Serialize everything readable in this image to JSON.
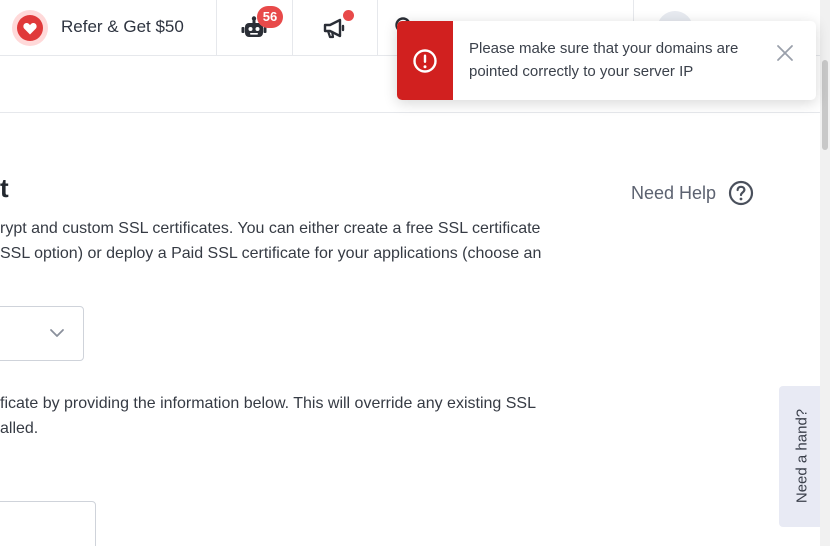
{
  "topbar": {
    "refer_label": "Refer & Get $50",
    "bot_badge": "56",
    "icons": [
      "heart-icon",
      "robot-icon",
      "megaphone-icon",
      "search-icon"
    ]
  },
  "main": {
    "title_fragment": "t",
    "para1_line1": "rypt and custom SSL certificates. You can either create a free SSL certificate",
    "para1_line2": "SSL option) or deploy a Paid SSL certificate for your applications (choose an",
    "para2_line1": "ficate by providing the information below. This will override any existing SSL",
    "para2_line2": "alled.",
    "need_help_label": "Need Help"
  },
  "side_tab": {
    "label": "Need a hand?"
  },
  "toast": {
    "message": "Please make sure that your domains are pointed correctly to your server IP",
    "accent_color": "#d1201f"
  }
}
